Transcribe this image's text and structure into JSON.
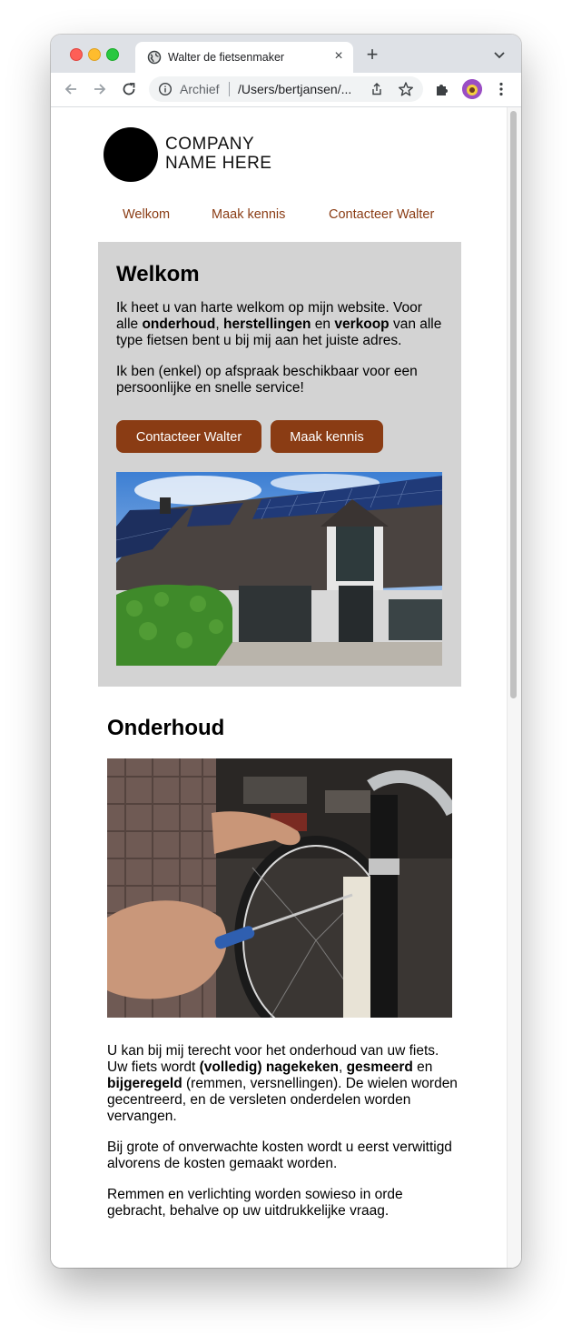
{
  "browser": {
    "tab_title": "Walter de fietsenmaker",
    "new_tab_symbol": "+",
    "close_symbol": "×",
    "omnibox": {
      "chip": "Archief",
      "url": "/Users/bertjansen/..."
    },
    "icons": [
      "back-arrow-icon",
      "forward-arrow-icon",
      "reload-icon",
      "info-icon",
      "share-icon",
      "star-icon",
      "extensions-puzzle-icon",
      "menu-dots-icon",
      "globe-icon",
      "tab-search-chevron-icon"
    ]
  },
  "logo": {
    "line1": "COMPANY",
    "line2": "NAME HERE"
  },
  "nav": {
    "items": [
      "Welkom",
      "Maak kennis",
      "Contacteer Walter"
    ]
  },
  "hero": {
    "title": "Welkom",
    "p1": {
      "a": "Ik heet u van harte welkom op mijn website. Voor alle ",
      "b1": "onderhoud",
      "c": ", ",
      "b2": "herstellingen",
      "d": " en ",
      "b3": "verkoop",
      "e": " van alle type fietsen bent u bij mij aan het juiste adres."
    },
    "p2": "Ik ben (enkel) op afspraak beschikbaar voor een persoonlijke en snelle service!",
    "buttons": {
      "contact": "Contacteer Walter",
      "about": "Maak kennis"
    }
  },
  "onderhoud": {
    "title": "Onderhoud",
    "p1": {
      "a": "U kan bij mij terecht voor het onderhoud van uw fiets. Uw fiets wordt ",
      "b1": "(volledig) nagekeken",
      "c": ", ",
      "b2": "gesmeerd",
      "d": " en ",
      "b3": "bijgeregeld",
      "e": " (remmen, versnellingen). De wielen worden gecentreerd, en de versleten onderdelen worden vervangen."
    },
    "p2": "Bij grote of onverwachte kosten wordt u eerst verwittigd alvorens de kosten gemaakt worden.",
    "p3": "Remmen en verlichting worden sowieso in orde gebracht, behalve op uw uitdrukkelijke vraag."
  },
  "colors": {
    "accent": "#8a3c14",
    "hero_bg": "#d3d3d3",
    "tabstrip_bg": "#dee1e6"
  }
}
